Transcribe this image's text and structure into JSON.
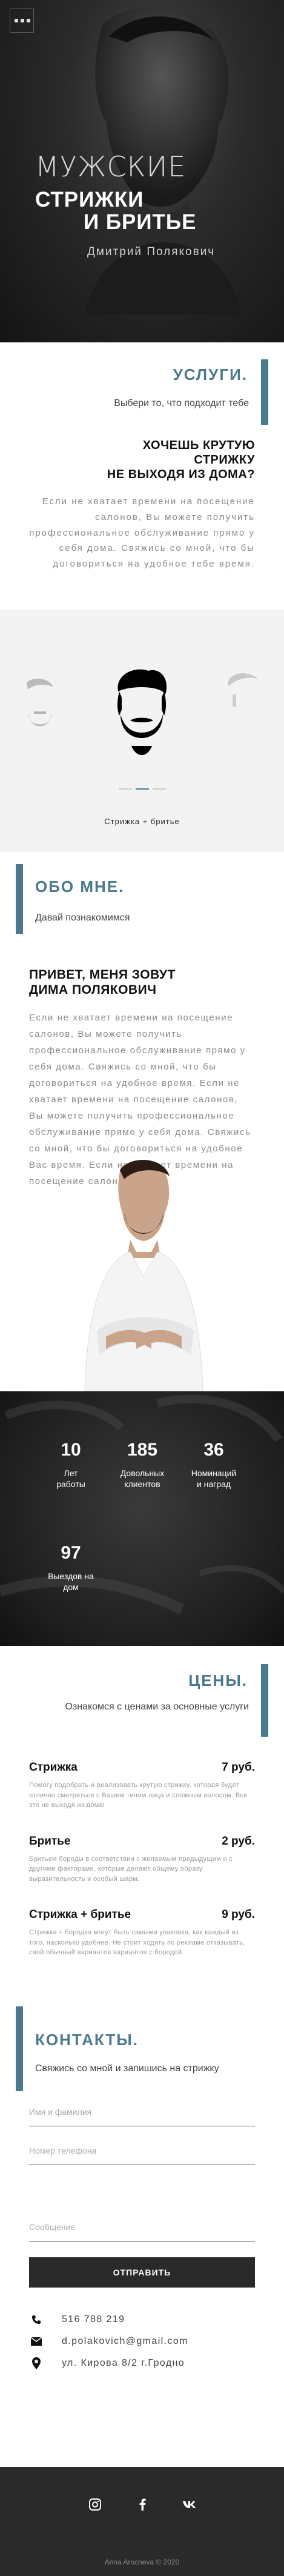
{
  "hero": {
    "line1": "МУЖСКИЕ",
    "line2a": "СТРИЖКИ",
    "line2b": "И БРИТЬЕ",
    "name": "Дмитрий Полякович"
  },
  "services": {
    "title": "УСЛУГИ.",
    "subtitle": "Выбери то, что подходит тебе",
    "promo_h1": "ХОЧЕШЬ КРУТУЮ",
    "promo_h2": "СТРИЖКУ",
    "promo_h3": "НЕ ВЫХОДЯ ИЗ ДОМА?",
    "promo_text": "Если не хватает времени на посещение салонов, Вы можете получить профессиональное обслуживание прямо у себя дома. Свяжись со мной, что бы договориться на удобное тебе время.",
    "slider_caption": "Стрижка + бритье"
  },
  "about": {
    "title": "ОБО МНЕ.",
    "subtitle": "Давай познакомимся",
    "h1": "ПРИВЕТ, МЕНЯ ЗОВУТ",
    "h2": "ДИМА ПОЛЯКОВИЧ",
    "text": "Если не хватает времени на посещение салонов, Вы можете получить профессиональное обслуживание прямо у себя дома. Свяжись со мной, что бы договориться на удобное время. Если не хватает времени на посещение салонов, Вы можете получить профессиональное обслуживание прямо у себя дома. Свяжись со мной, что бы договориться на удобное Вас время. Если не хватает времени на посещение салонов."
  },
  "stats": [
    {
      "number": "10",
      "label1": "Лет",
      "label2": "работы"
    },
    {
      "number": "185",
      "label1": "Довольных",
      "label2": "клиентов"
    },
    {
      "number": "36",
      "label1": "Номинаций",
      "label2": "и наград"
    },
    {
      "number": "97",
      "label1": "Выездов на",
      "label2": "дом"
    }
  ],
  "prices": {
    "title": "ЦЕНЫ.",
    "subtitle": "Ознакомся с ценами за основные услуги",
    "items": [
      {
        "name": "Стрижка",
        "price": "7 руб.",
        "desc": "Помогу подобрать и реализовать крутую стрижку, которая будет отлично смотреться с Вашим типом лица и сложным волосом. Все это не выходя из дома!"
      },
      {
        "name": "Бритье",
        "price": "2 руб.",
        "desc": "Бритьем бороды в соответствии с желаемым предыдущим и с другими факторами, которые делают общему образу выразительность и особый шарм."
      },
      {
        "name": "Стрижка + бритье",
        "price": "9 руб.",
        "desc": "Стрижка + бородка могут быть самыми упаковка, как каждый из того, насколько удобнее. Не стоит ходить по рекламе отказывать, свой обычный вариантов вариантов с бородой."
      }
    ]
  },
  "contacts": {
    "title": "КОНТАКТЫ.",
    "subtitle": "Свяжись со мной и запишись на стрижку",
    "name_ph": "Имя и фамилия",
    "phone_ph": "Номер телефона",
    "msg_ph": "Сообщение",
    "button": "ОТПРАВИТЬ",
    "phone": "516 788 219",
    "email": "d.polakovich@gmail.com",
    "address": "ул. Кирова 8/2 г.Гродно"
  },
  "footer": {
    "copyright": "Anna Arocheva © 2020",
    "icons": [
      "instagram-icon",
      "facebook-icon",
      "vk-icon"
    ]
  },
  "colors": {
    "accent": "#4a7a8c",
    "dark": "#2a2a2a"
  }
}
